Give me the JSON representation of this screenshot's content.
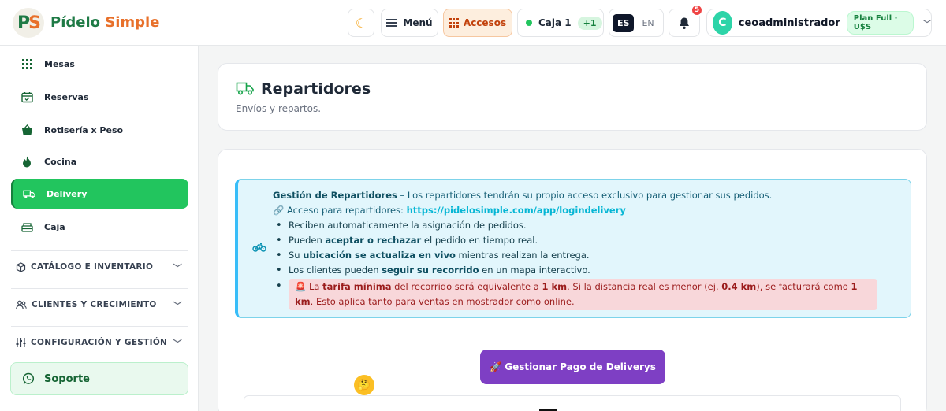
{
  "app": {
    "logo_letters": [
      "P",
      "S"
    ],
    "brand_word1": "Pídelo",
    "brand_word2": "Simple"
  },
  "header": {
    "theme_icon": "moon-icon",
    "menu_label": "Menú",
    "accesos_label": "Accesos",
    "caja_label": "Caja 1",
    "caja_badge": "+1",
    "lang_es": "ES",
    "lang_en": "EN",
    "notifications_count": "5",
    "user_initial": "C",
    "username": "ceoadministrador",
    "plan_label": "Plan Full · U$S"
  },
  "sidebar": {
    "items": [
      {
        "label": "Mesas",
        "icon": "grid-icon"
      },
      {
        "label": "Reservas",
        "icon": "calendar-icon"
      },
      {
        "label": "Rotisería x Peso",
        "icon": "basket-icon"
      },
      {
        "label": "Cocina",
        "icon": "flame-icon"
      },
      {
        "label": "Delivery",
        "icon": "truck-icon",
        "active": true
      },
      {
        "label": "Caja",
        "icon": "cash-register-icon"
      }
    ],
    "sections": [
      {
        "label": "CATÁLOGO E INVENTARIO",
        "icon": "box-icon"
      },
      {
        "label": "CLIENTES Y CRECIMIENTO",
        "icon": "users-icon"
      },
      {
        "label": "CONFIGURACIÓN Y GESTIÓN",
        "icon": "sliders-icon"
      }
    ],
    "support_label": "Soporte"
  },
  "page": {
    "title": "Repartidores",
    "subtitle": "Envíos y repartos."
  },
  "info": {
    "heading_bold": "Gestión de Repartidores",
    "heading_rest": " – Los repartidores tendrán su propio acceso exclusivo para gestionar sus pedidos.",
    "access_prefix": "🔗 Acceso para repartidores: ",
    "access_link": "https://pidelosimple.com/app/logindelivery",
    "bullet1": "Reciben automaticamente la asignación de pedidos.",
    "bullet2_pre": "Pueden ",
    "bullet2_bold": "aceptar o rechazar",
    "bullet2_post": " el pedido en tiempo real.",
    "bullet3_pre": "Su ",
    "bullet3_bold": "ubicación se actualiza en vivo",
    "bullet3_post": " mientras realizan la entrega.",
    "bullet4_pre": "Los clientes pueden ",
    "bullet4_bold": "seguir su recorrido",
    "bullet4_post": " en un mapa interactivo.",
    "alert_icon": "🚨",
    "alert_p1": " La ",
    "alert_b1": "tarifa mínima",
    "alert_p2": " del recorrido será equivalente a ",
    "alert_b2": "1 km",
    "alert_p3": ". Si la distancia real es menor (ej. ",
    "alert_b3": "0.4 km",
    "alert_p4": "), se facturará como ",
    "alert_b4": "1 km",
    "alert_p5": ". Esto aplica tanto para ventas en mostrador como online."
  },
  "actions": {
    "pay_button": "🚀 Gestionar Pago de Deliverys"
  },
  "colors": {
    "brand_green": "#1e7a45",
    "brand_orange": "#e8702a",
    "active_green": "#22c55e",
    "purple_button": "#7e3fc4",
    "info_bg": "#e2f6fc",
    "alert_bg": "#f8d7da"
  }
}
